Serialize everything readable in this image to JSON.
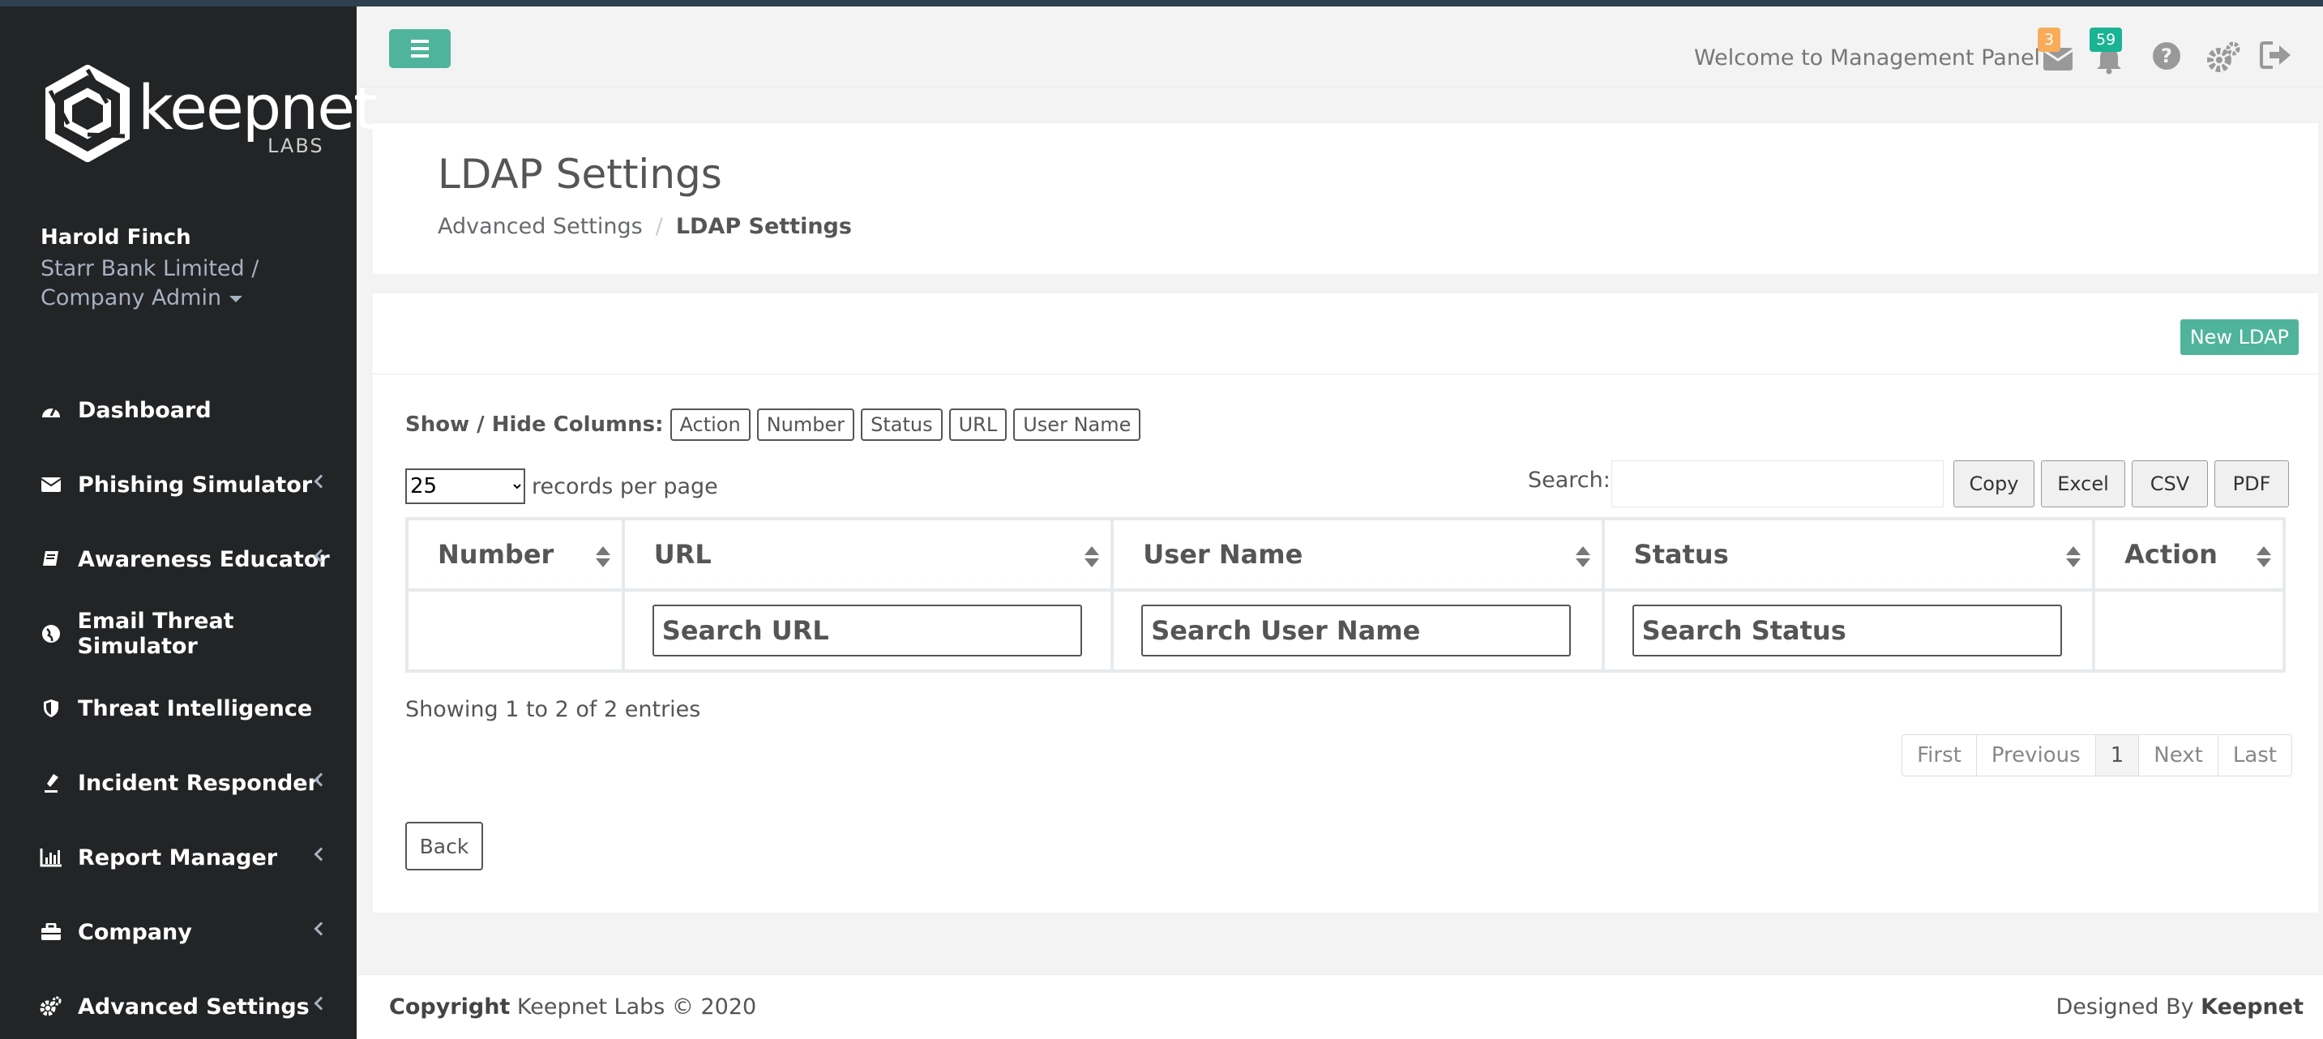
{
  "brand": {
    "name": "keepnet",
    "sub": "LABS"
  },
  "user": {
    "name": "Harold Finch",
    "company_line1": "Starr Bank Limited /",
    "company_line2": "Company Admin"
  },
  "nav": [
    {
      "label": "Dashboard",
      "icon": "dashboard-icon",
      "has_submenu": false
    },
    {
      "label": "Phishing Simulator",
      "icon": "envelope-icon",
      "has_submenu": true
    },
    {
      "label": "Awareness Educator",
      "icon": "book-icon",
      "has_submenu": true
    },
    {
      "label": "Email Threat Simulator",
      "icon": "globe-icon",
      "has_submenu": false
    },
    {
      "label": "Threat Intelligence",
      "icon": "shield-icon",
      "has_submenu": false
    },
    {
      "label": "Incident Responder",
      "icon": "fire-icon",
      "has_submenu": true
    },
    {
      "label": "Report Manager",
      "icon": "bar-chart-icon",
      "has_submenu": true
    },
    {
      "label": "Company",
      "icon": "briefcase-icon",
      "has_submenu": true
    },
    {
      "label": "Advanced Settings",
      "icon": "gears-icon",
      "has_submenu": true
    }
  ],
  "header": {
    "welcome": "Welcome to Management Panel",
    "mail_count": "3",
    "notification_count": "59",
    "mail_badge_color": "#f8ac59",
    "notification_badge_color": "#1ab394"
  },
  "page": {
    "title": "LDAP Settings",
    "breadcrumb_parent": "Advanced Settings",
    "breadcrumb_separator": "/",
    "breadcrumb_current": "LDAP Settings"
  },
  "toolbar": {
    "new_label": "New LDAP"
  },
  "columns_toggle": {
    "label": "Show / Hide Columns:",
    "buttons": [
      "Action",
      "Number",
      "Status",
      "URL",
      "User Name"
    ]
  },
  "records": {
    "value": "25",
    "options": [
      "25"
    ],
    "suffix": "records per page"
  },
  "search": {
    "label": "Search:",
    "value": ""
  },
  "export": {
    "copy": "Copy",
    "excel": "Excel",
    "csv": "CSV",
    "pdf": "PDF"
  },
  "table": {
    "headers": [
      "Number",
      "URL",
      "User Name",
      "Status",
      "Action"
    ],
    "filters": {
      "url": "Search URL",
      "user_name": "Search User Name",
      "status": "Search Status"
    }
  },
  "info": "Showing 1 to 2 of 2 entries",
  "pagination": {
    "first": "First",
    "previous": "Previous",
    "current": "1",
    "next": "Next",
    "last": "Last"
  },
  "back_label": "Back",
  "footer": {
    "copyright_bold": "Copyright",
    "copyright_text": " Keepnet Labs © 2020",
    "designed_text": "Designed By ",
    "designed_bold": "Keepnet"
  },
  "colors": {
    "accent": "#4fb49b",
    "sidebar": "#222426"
  }
}
